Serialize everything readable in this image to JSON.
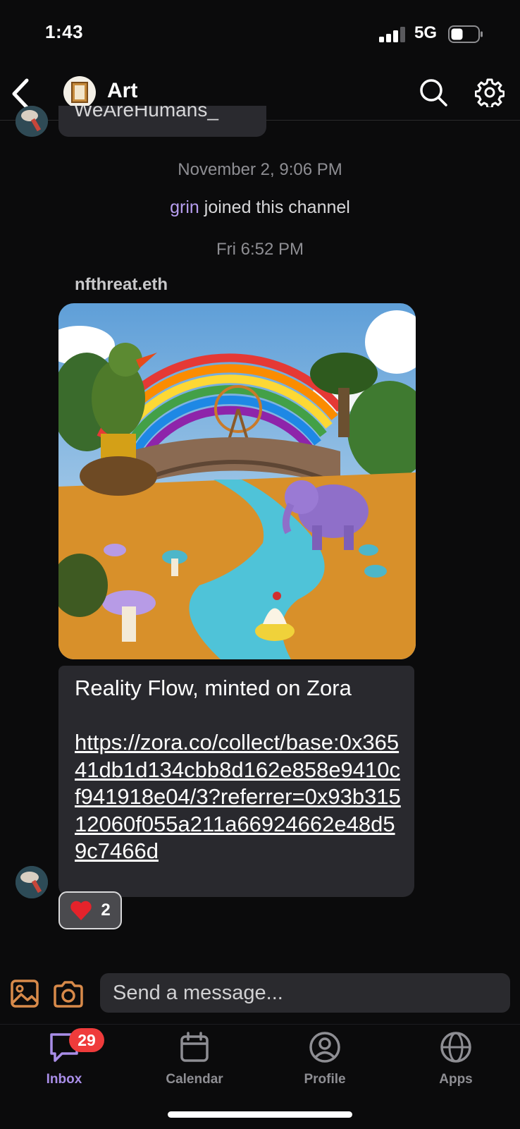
{
  "status_bar": {
    "time": "1:43",
    "network": "5G"
  },
  "header": {
    "channel_name": "Art"
  },
  "chat": {
    "previous_message_fragment": "WeAreHumans_",
    "timestamp_1": "November 2, 9:06 PM",
    "join_event": {
      "user": "grin",
      "text": " joined this channel"
    },
    "timestamp_2": "Fri 6:52 PM",
    "message": {
      "author": "nfthreat.eth",
      "title": "Reality Flow, minted on Zora",
      "link": "https://zora.co/collect/base:0x36541db1d134cbb8d162e858e9410cf941918e04/3?referrer=0x93b31512060f055a211a66924662e48d59c7466d",
      "reaction": {
        "emoji": "❤️",
        "count": "2"
      }
    }
  },
  "composer": {
    "placeholder": "Send a message..."
  },
  "tabbar": {
    "inbox_badge": "29",
    "tabs": [
      {
        "label": "Inbox",
        "icon": "chat-bubble-icon",
        "active": true
      },
      {
        "label": "Calendar",
        "icon": "calendar-icon"
      },
      {
        "label": "Profile",
        "icon": "person-icon"
      },
      {
        "label": "Apps",
        "icon": "globe-icon"
      }
    ]
  },
  "colors": {
    "background": "#0b0b0c",
    "bubble": "#29292e",
    "accent": "#a98ee8",
    "badge": "#ef3b3b",
    "username": "#b79ef0"
  }
}
